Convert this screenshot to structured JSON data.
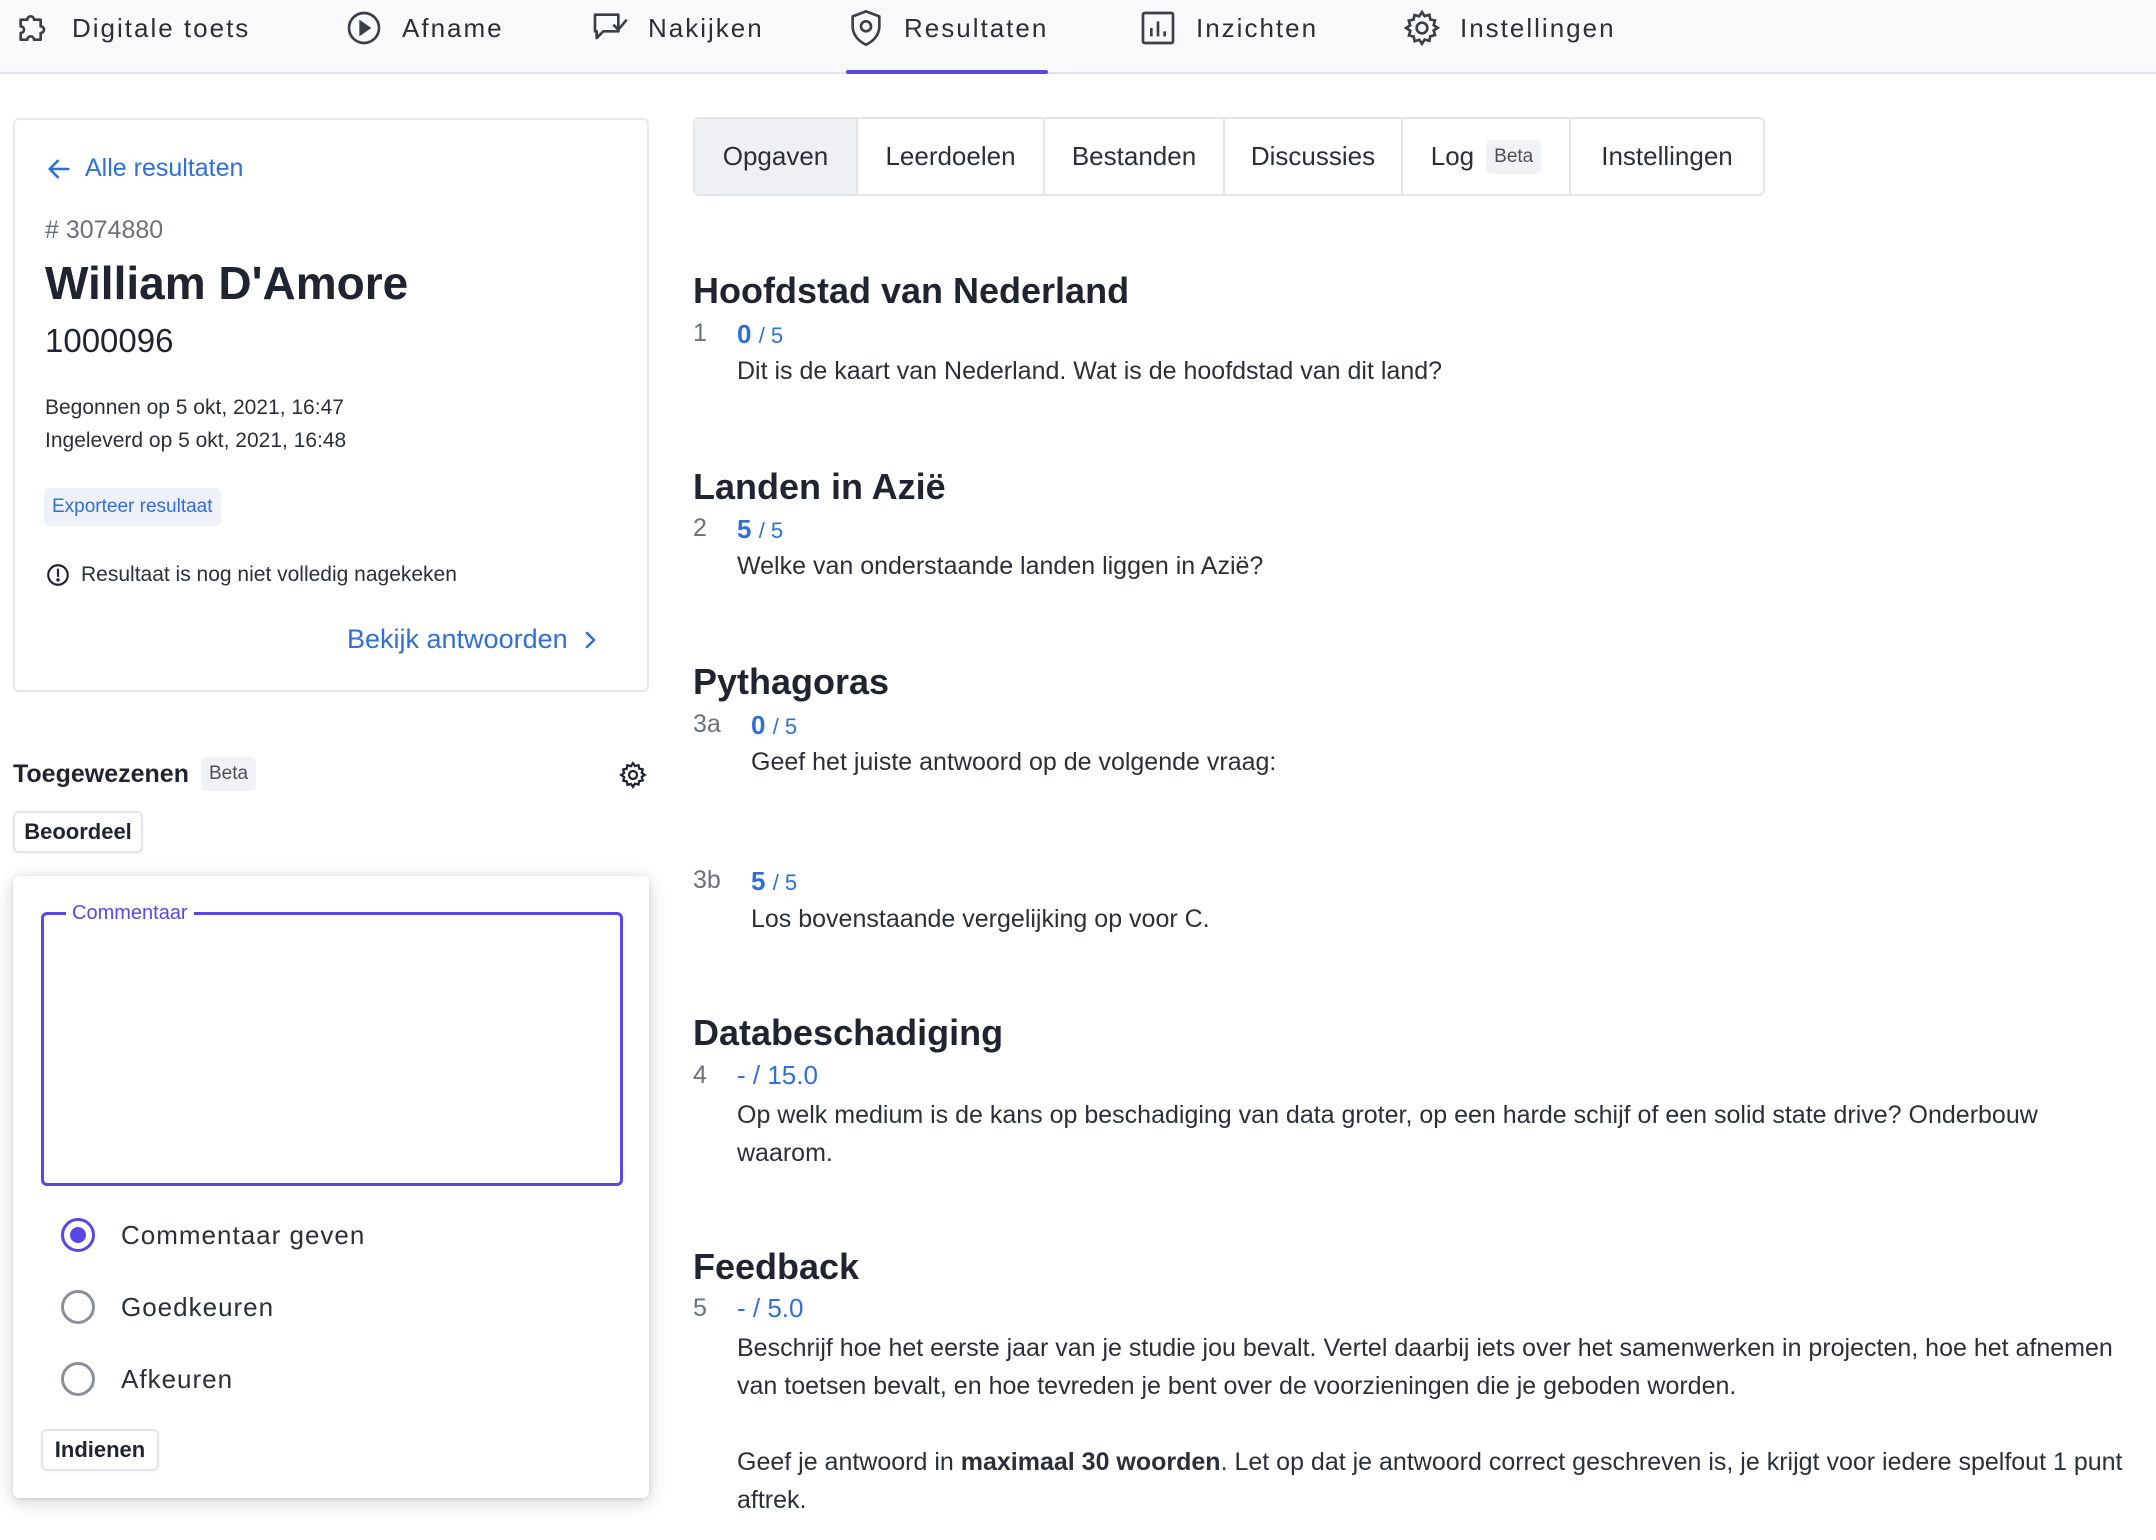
{
  "nav": {
    "items": [
      {
        "label": "Digitale toets",
        "icon": "puzzle-icon"
      },
      {
        "label": "Afname",
        "icon": "play-circle-icon"
      },
      {
        "label": "Nakijken",
        "icon": "chat-check-icon"
      },
      {
        "label": "Resultaten",
        "icon": "shield-icon"
      },
      {
        "label": "Inzichten",
        "icon": "bar-chart-icon"
      },
      {
        "label": "Instellingen",
        "icon": "gear-icon"
      }
    ],
    "active": "Resultaten",
    "accent_color": "#5b46e6"
  },
  "student": {
    "back_link": "Alle resultaten",
    "result_id": "# 3074880",
    "name": "William D'Amore",
    "number": "1000096",
    "started": "Begonnen op 5 okt, 2021, 16:47",
    "submitted": "Ingeleverd op 5 okt, 2021, 16:48",
    "export_label": "Exporteer resultaat",
    "status_text": "Resultaat is nog niet volledig nagekeken",
    "view_answers": "Bekijk antwoorden"
  },
  "assignees": {
    "title": "Toegewezenen",
    "beta": "Beta",
    "review_button": "Beoordeel"
  },
  "review_popup": {
    "comment_legend": "Commentaar",
    "comment_value": "",
    "options": [
      "Commentaar geven",
      "Goedkeuren",
      "Afkeuren"
    ],
    "selected": "Commentaar geven",
    "submit_label": "Indienen"
  },
  "tabs": {
    "items": [
      "Opgaven",
      "Leerdoelen",
      "Bestanden",
      "Discussies",
      "Log",
      "Instellingen"
    ],
    "log_badge": "Beta",
    "active": "Opgaven"
  },
  "questions": [
    {
      "title": "Hoofdstad van Nederland",
      "num": "1",
      "score": "0",
      "max": "/ 5",
      "text": "Dit is de kaart van Nederland. Wat is de hoofdstad van dit land?"
    },
    {
      "title": "Landen in Azië",
      "num": "2",
      "score": "5",
      "max": "/ 5",
      "text": "Welke van onderstaande landen liggen in Azië?"
    },
    {
      "title": "Pythagoras",
      "num": "3a",
      "score": "0",
      "max": "/ 5",
      "text": "Geef het juiste antwoord op de volgende vraag:"
    },
    {
      "title": "",
      "num": "3b",
      "score": "5",
      "max": "/ 5",
      "text": "Los bovenstaande vergelijking op voor C."
    },
    {
      "title": "Databeschadiging",
      "num": "4",
      "score": "- / 15.0",
      "max": "",
      "text": "Op welk medium is de kans op beschadiging van data groter, op een harde schijf of een solid state drive? Onderbouw waarom."
    },
    {
      "title": "Feedback",
      "num": "5",
      "score": "- / 5.0",
      "max": "",
      "text": "Beschrijf hoe het eerste jaar van je studie jou bevalt. Vertel daarbij iets over het samenwerken in projecten, hoe het afnemen van toetsen bevalt, en hoe tevreden je bent over de voorzieningen die je geboden worden.",
      "text2_before": "Geef je antwoord in ",
      "text2_bold": "maximaal 30 woorden",
      "text2_after": ". Let op dat je antwoord correct geschreven is, je krijgt voor iedere spelfout 1 punt aftrek."
    }
  ]
}
